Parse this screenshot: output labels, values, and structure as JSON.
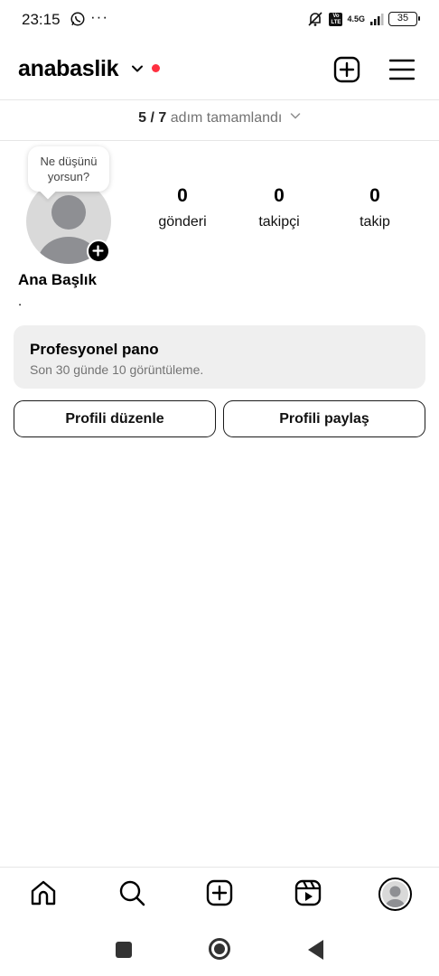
{
  "status_bar": {
    "time": "23:15",
    "dots": "···",
    "network_top": "4.5G",
    "volte": "Vo LTE",
    "battery": "35",
    "icons": [
      "whatsapp-icon",
      "mute-icon",
      "volte-icon",
      "signal-icon",
      "battery-icon"
    ]
  },
  "header": {
    "username": "anabaslik",
    "notification_color": "#ff3040",
    "icons": [
      "chevron-down-icon",
      "add-post-icon",
      "menu-icon"
    ]
  },
  "progress": {
    "count": "5 / 7",
    "text": "adım tamamlandı"
  },
  "profile": {
    "note_bubble": "Ne düşünü yorsun?",
    "name": "Ana Başlık",
    "bio": ".",
    "stats": [
      {
        "value": "0",
        "label": "gönderi"
      },
      {
        "value": "0",
        "label": "takipçi"
      },
      {
        "value": "0",
        "label": "takip"
      }
    ]
  },
  "pro_panel": {
    "title": "Profesyonel pano",
    "subtitle": "Son 30 günde 10 görüntüleme."
  },
  "buttons": {
    "edit_profile": "Profili düzenle",
    "share_profile": "Profili paylaş"
  },
  "bottom_nav": {
    "items": [
      "home-icon",
      "search-icon",
      "create-icon",
      "reels-icon",
      "profile-avatar"
    ]
  },
  "system_nav": {
    "items": [
      "recents-button",
      "home-button",
      "back-button"
    ]
  }
}
